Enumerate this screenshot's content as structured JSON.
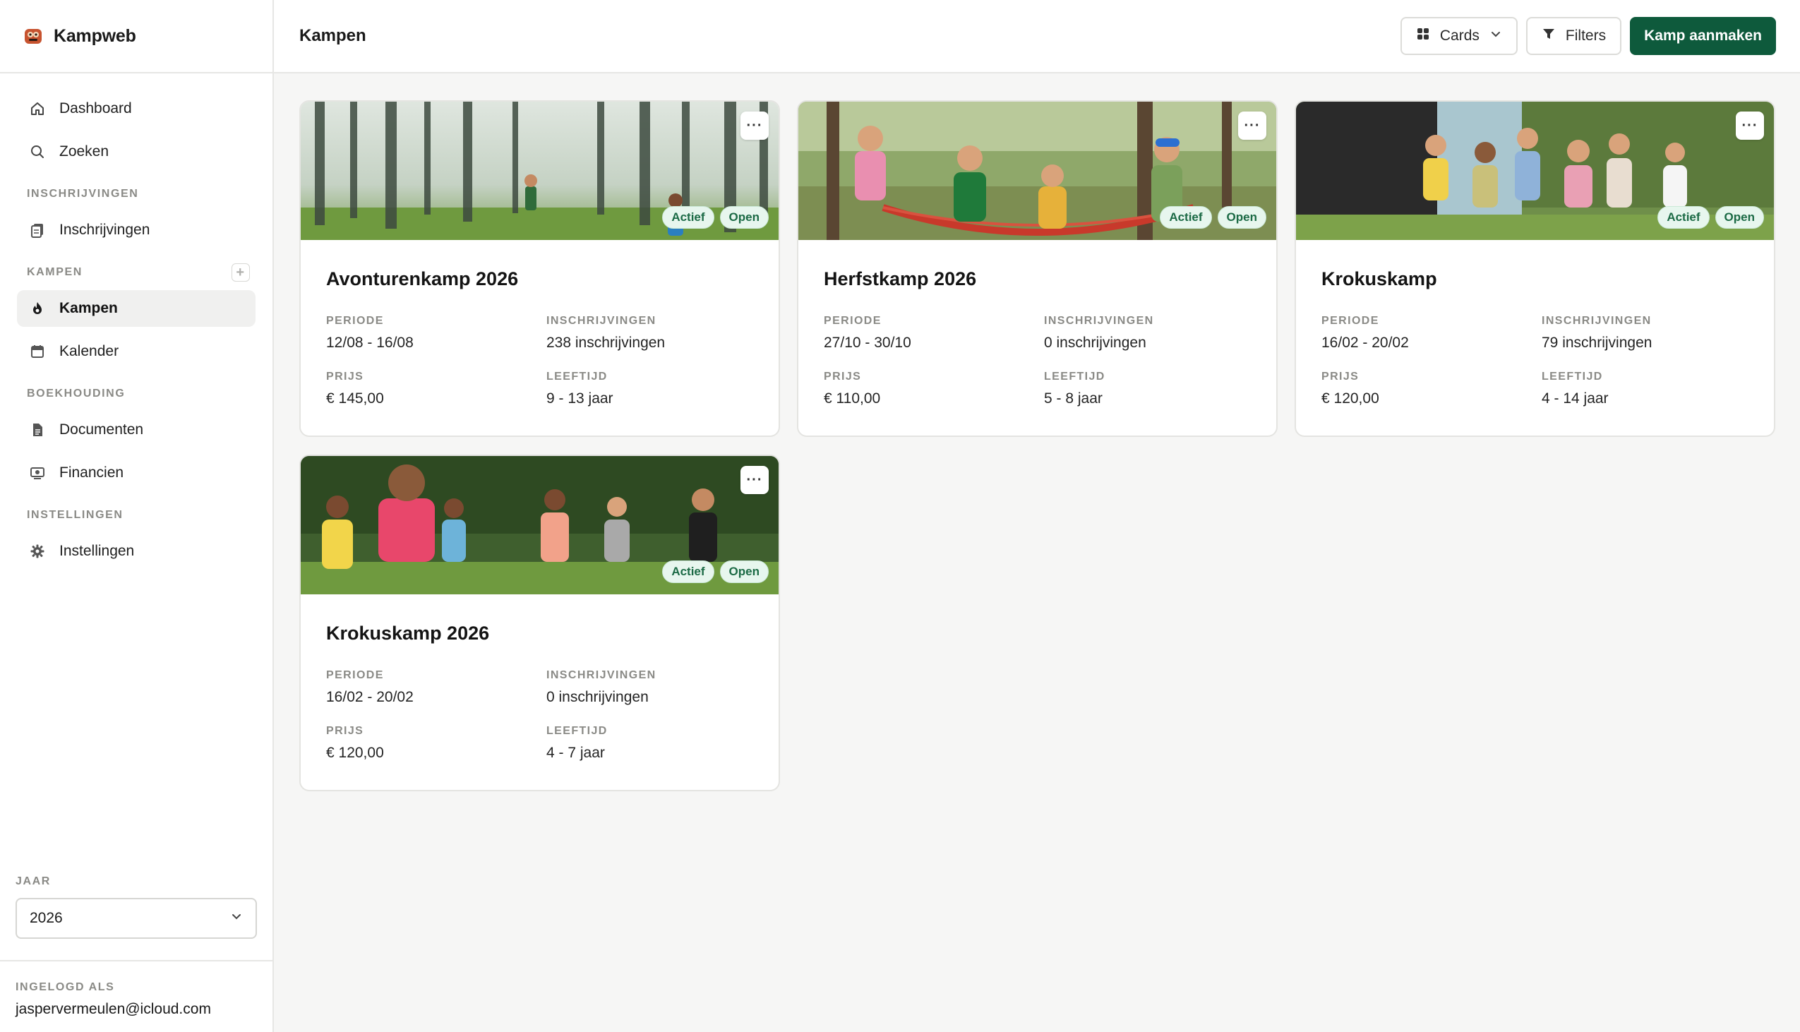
{
  "app": {
    "name": "Kampweb"
  },
  "sidebar": {
    "items_top": [
      {
        "label": "Dashboard",
        "icon": "home-icon"
      },
      {
        "label": "Zoeken",
        "icon": "search-icon"
      }
    ],
    "sections": [
      {
        "label": "INSCHRIJVINGEN",
        "items": [
          {
            "label": "Inschrijvingen",
            "icon": "document-stack-icon"
          }
        ]
      },
      {
        "label": "KAMPEN",
        "items": [
          {
            "label": "Kampen",
            "icon": "flame-icon"
          },
          {
            "label": "Kalender",
            "icon": "calendar-icon"
          }
        ]
      },
      {
        "label": "BOEKHOUDING",
        "items": [
          {
            "label": "Documenten",
            "icon": "file-icon"
          },
          {
            "label": "Financien",
            "icon": "money-icon"
          }
        ]
      },
      {
        "label": "INSTELLINGEN",
        "items": [
          {
            "label": "Instellingen",
            "icon": "gear-icon"
          }
        ]
      }
    ],
    "year": {
      "label": "JAAR",
      "value": "2026"
    },
    "user": {
      "label": "INGELOGD ALS",
      "email": "jaspervermeulen@icloud.com"
    }
  },
  "header": {
    "title": "Kampen",
    "view_label": "Cards",
    "filters_label": "Filters",
    "create_label": "Kamp aanmaken"
  },
  "labels": {
    "periode": "PERIODE",
    "inschrijvingen": "INSCHRIJVINGEN",
    "prijs": "PRIJS",
    "leeftijd": "LEEFTIJD",
    "menu": "···"
  },
  "camps": [
    {
      "title": "Avonturenkamp 2026",
      "periode": "12/08 - 16/08",
      "inschrijvingen": "238 inschrijvingen",
      "prijs": "€ 145,00",
      "leeftijd": "9 - 13 jaar",
      "badges": [
        "Actief",
        "Open"
      ]
    },
    {
      "title": "Herfstkamp 2026",
      "periode": "27/10 - 30/10",
      "inschrijvingen": "0 inschrijvingen",
      "prijs": "€ 110,00",
      "leeftijd": "5 - 8 jaar",
      "badges": [
        "Actief",
        "Open"
      ]
    },
    {
      "title": "Krokuskamp",
      "periode": "16/02 - 20/02",
      "inschrijvingen": "79 inschrijvingen",
      "prijs": "€ 120,00",
      "leeftijd": "4 - 14 jaar",
      "badges": [
        "Actief",
        "Open"
      ]
    },
    {
      "title": "Krokuskamp 2026",
      "periode": "16/02 - 20/02",
      "inschrijvingen": "0 inschrijvingen",
      "prijs": "€ 120,00",
      "leeftijd": "4 - 7 jaar",
      "badges": [
        "Actief",
        "Open"
      ]
    }
  ],
  "colors": {
    "primary": "#0e5a3c",
    "badge_bg": "#e7f6ee",
    "badge_text": "#1b6a45"
  }
}
